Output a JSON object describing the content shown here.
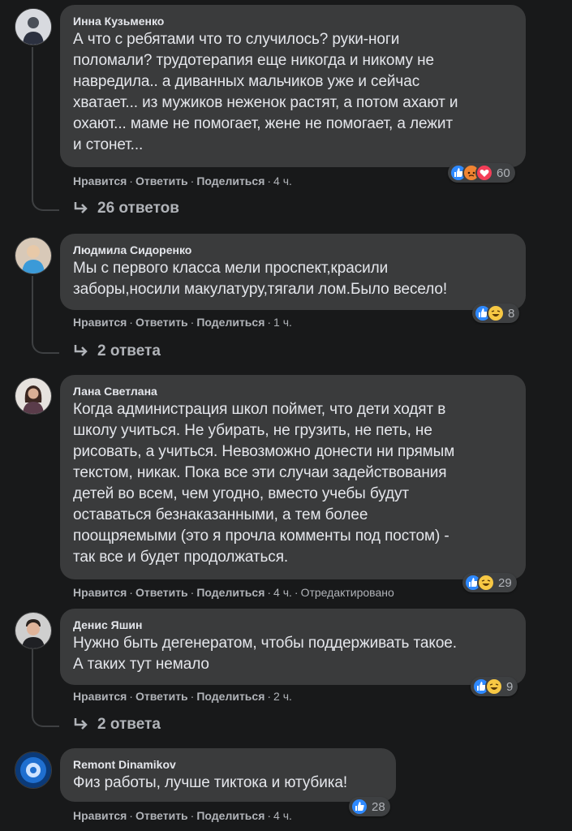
{
  "actions": {
    "like": "Нравится",
    "reply": "Ответить",
    "share": "Поделиться"
  },
  "colors": {
    "background": "#18191a",
    "bubble": "#3a3b3c",
    "like": "#2e89ff",
    "angry": "#f08432",
    "love": "#f33e58",
    "haha": "#f7c844"
  },
  "comments": [
    {
      "author": "Инна Кузьменко",
      "text": "А что с ребятами что то случилось? руки-ноги\nполомали? трудотерапия еще никогда и никому не\nнавредила.. а диванных мальчиков уже и сейчас\nхватает... из мужиков неженок растят, а потом ахают и\nохают... маме не помогает, жене не помогает, а лежит\nи стонет...",
      "time": "4 ч.",
      "reactions": [
        "like-icon",
        "angry-icon",
        "love-icon"
      ],
      "reaction_count": "60",
      "replies": "26 ответов"
    },
    {
      "author": "Людмила Сидоренко",
      "text": "Мы с первого класса мели проспект,красили\nзаборы,носили макулатуру,тягали лом.Было весело!",
      "time": "1 ч.",
      "reactions": [
        "like-icon",
        "haha-icon"
      ],
      "reaction_count": "8",
      "replies": "2 ответа"
    },
    {
      "author": "Лана Светлана",
      "text": "Когда администрация школ поймет, что дети ходят в\nшколу учиться. Не убирать, не грузить, не петь, не\nрисовать, а учиться. Невозможно донести ни прямым\nтекстом, никак. Пока все эти случаи задействования\nдетей во всем, чем угодно, вместо учебы будут\nоставаться безнаказанными, а тем более\nпоощряемыми (это я прочла комменты под постом) -\nтак все и будет продолжаться.",
      "time": "4 ч.",
      "edited": "Отредактировано",
      "reactions": [
        "like-icon",
        "haha-icon"
      ],
      "reaction_count": "29"
    },
    {
      "author": "Денис Яшин",
      "text": "Нужно быть дегенератом, чтобы поддерживать такое.\nА таких тут немало",
      "time": "2 ч.",
      "reactions": [
        "like-icon",
        "haha-icon"
      ],
      "reaction_count": "9",
      "replies": "2 ответа"
    },
    {
      "author": "Remont Dinamikov",
      "text": "Физ работы, лучше тиктока и ютубика!",
      "time": "4 ч.",
      "reactions": [
        "like-icon"
      ],
      "reaction_count": "28"
    }
  ]
}
